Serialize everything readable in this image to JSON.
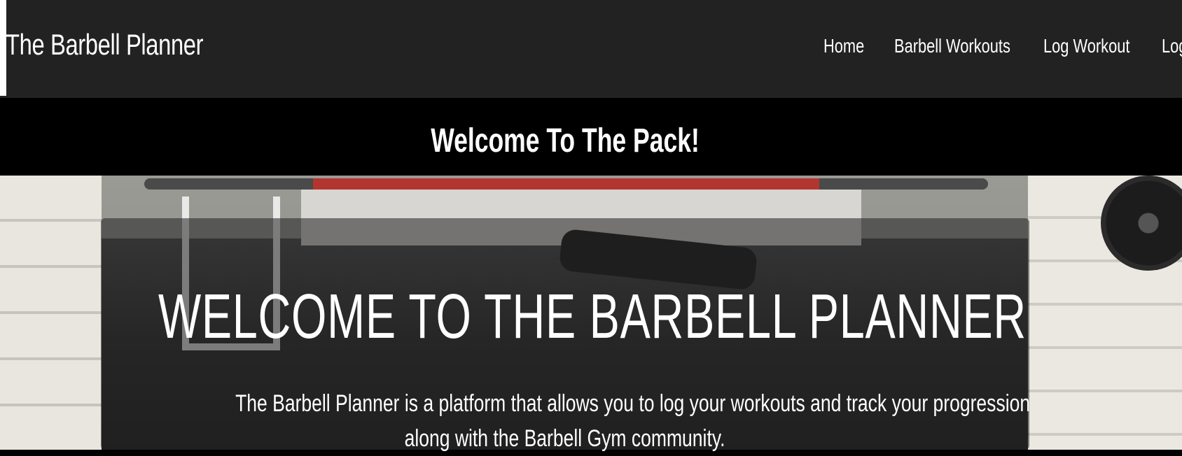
{
  "brand": {
    "title": "The Barbell Planner"
  },
  "nav": {
    "items": [
      {
        "label": "Home"
      },
      {
        "label": "Barbell Workouts"
      },
      {
        "label": "Log Workout"
      },
      {
        "label": "Log"
      }
    ]
  },
  "welcome": {
    "title": "Welcome To The Pack!"
  },
  "hero": {
    "heading": "WELCOME TO THE BARBELL PLANNER",
    "line1": "The Barbell Planner is a platform that allows you to log your workouts and track your progression",
    "line2": "along with the Barbell Gym community."
  },
  "colors": {
    "navbar_bg": "#222222",
    "band_bg": "#000000",
    "text": "#ffffff",
    "accent_bar": "#b3352f"
  }
}
